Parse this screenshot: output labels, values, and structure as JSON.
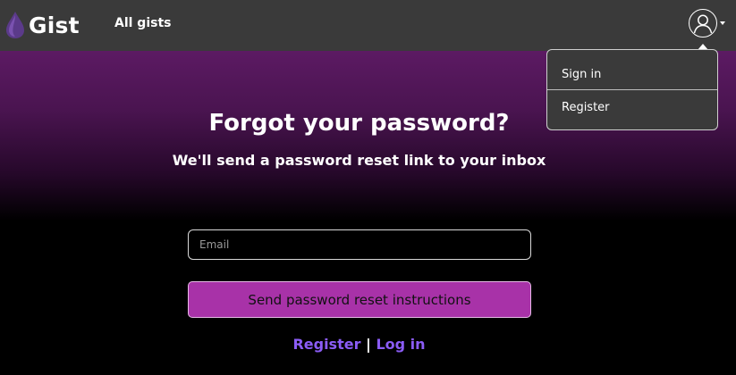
{
  "navbar": {
    "logo_text": "Gist",
    "links": [
      {
        "label": "All gists"
      }
    ]
  },
  "user_menu": {
    "items": [
      {
        "label": "Sign in"
      },
      {
        "label": "Register"
      }
    ]
  },
  "hero": {
    "title": "Forgot your password?",
    "subtitle": "We'll send a password reset link to your inbox"
  },
  "form": {
    "email_placeholder": "Email",
    "submit_label": "Send password reset instructions"
  },
  "footer_links": {
    "register": "Register",
    "separator": "|",
    "login": "Log in"
  },
  "colors": {
    "navbar_bg": "#3a3a3a",
    "hero_gradient_top": "#5c1a63",
    "button_bg": "#a832a8",
    "link_color": "#8b5cf6"
  },
  "icons": {
    "logo": "droplet-icon",
    "avatar": "user-icon",
    "caret": "caret-down-icon"
  }
}
